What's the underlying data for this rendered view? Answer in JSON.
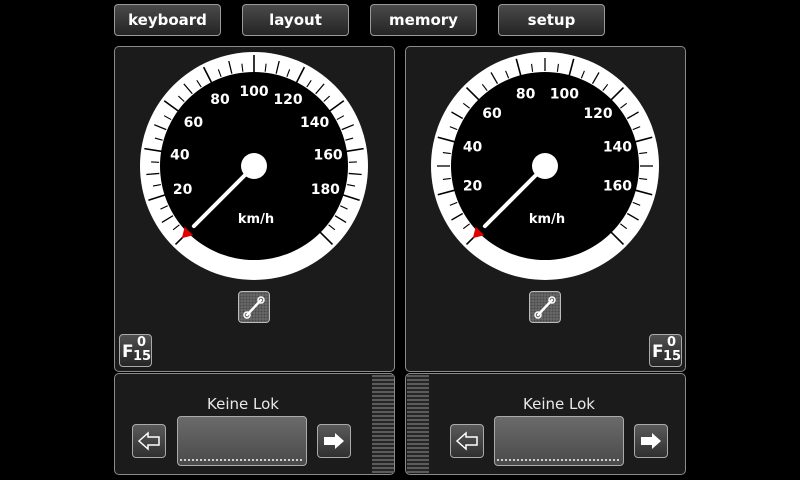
{
  "topbar": {
    "keyboard": "keyboard",
    "layout": "layout",
    "memory": "memory",
    "setup": "setup"
  },
  "controllers": [
    {
      "gauge": {
        "unit": "km/h",
        "min": 0,
        "max": 200,
        "labels": [
          "20",
          "40",
          "60",
          "80",
          "100",
          "120",
          "140",
          "160",
          "180"
        ],
        "speed": 0
      },
      "function_button": {
        "letter": "F",
        "top": "0",
        "bottom": "15"
      },
      "loco_name": "Keine Lok"
    },
    {
      "gauge": {
        "unit": "km/h",
        "min": 0,
        "max": 180,
        "labels": [
          "20",
          "40",
          "60",
          "80",
          "100",
          "120",
          "140",
          "160"
        ],
        "speed": 0
      },
      "function_button": {
        "letter": "F",
        "top": "0",
        "bottom": "15"
      },
      "loco_name": "Keine Lok"
    }
  ],
  "colors": {
    "needle": "#ffffff",
    "zero_marker": "#e00000",
    "dial_face": "#000000",
    "dial_ring": "#ffffff"
  },
  "icons": {
    "tool": "wrench-icon",
    "left": "arrow-left-icon",
    "right": "arrow-right-icon"
  }
}
